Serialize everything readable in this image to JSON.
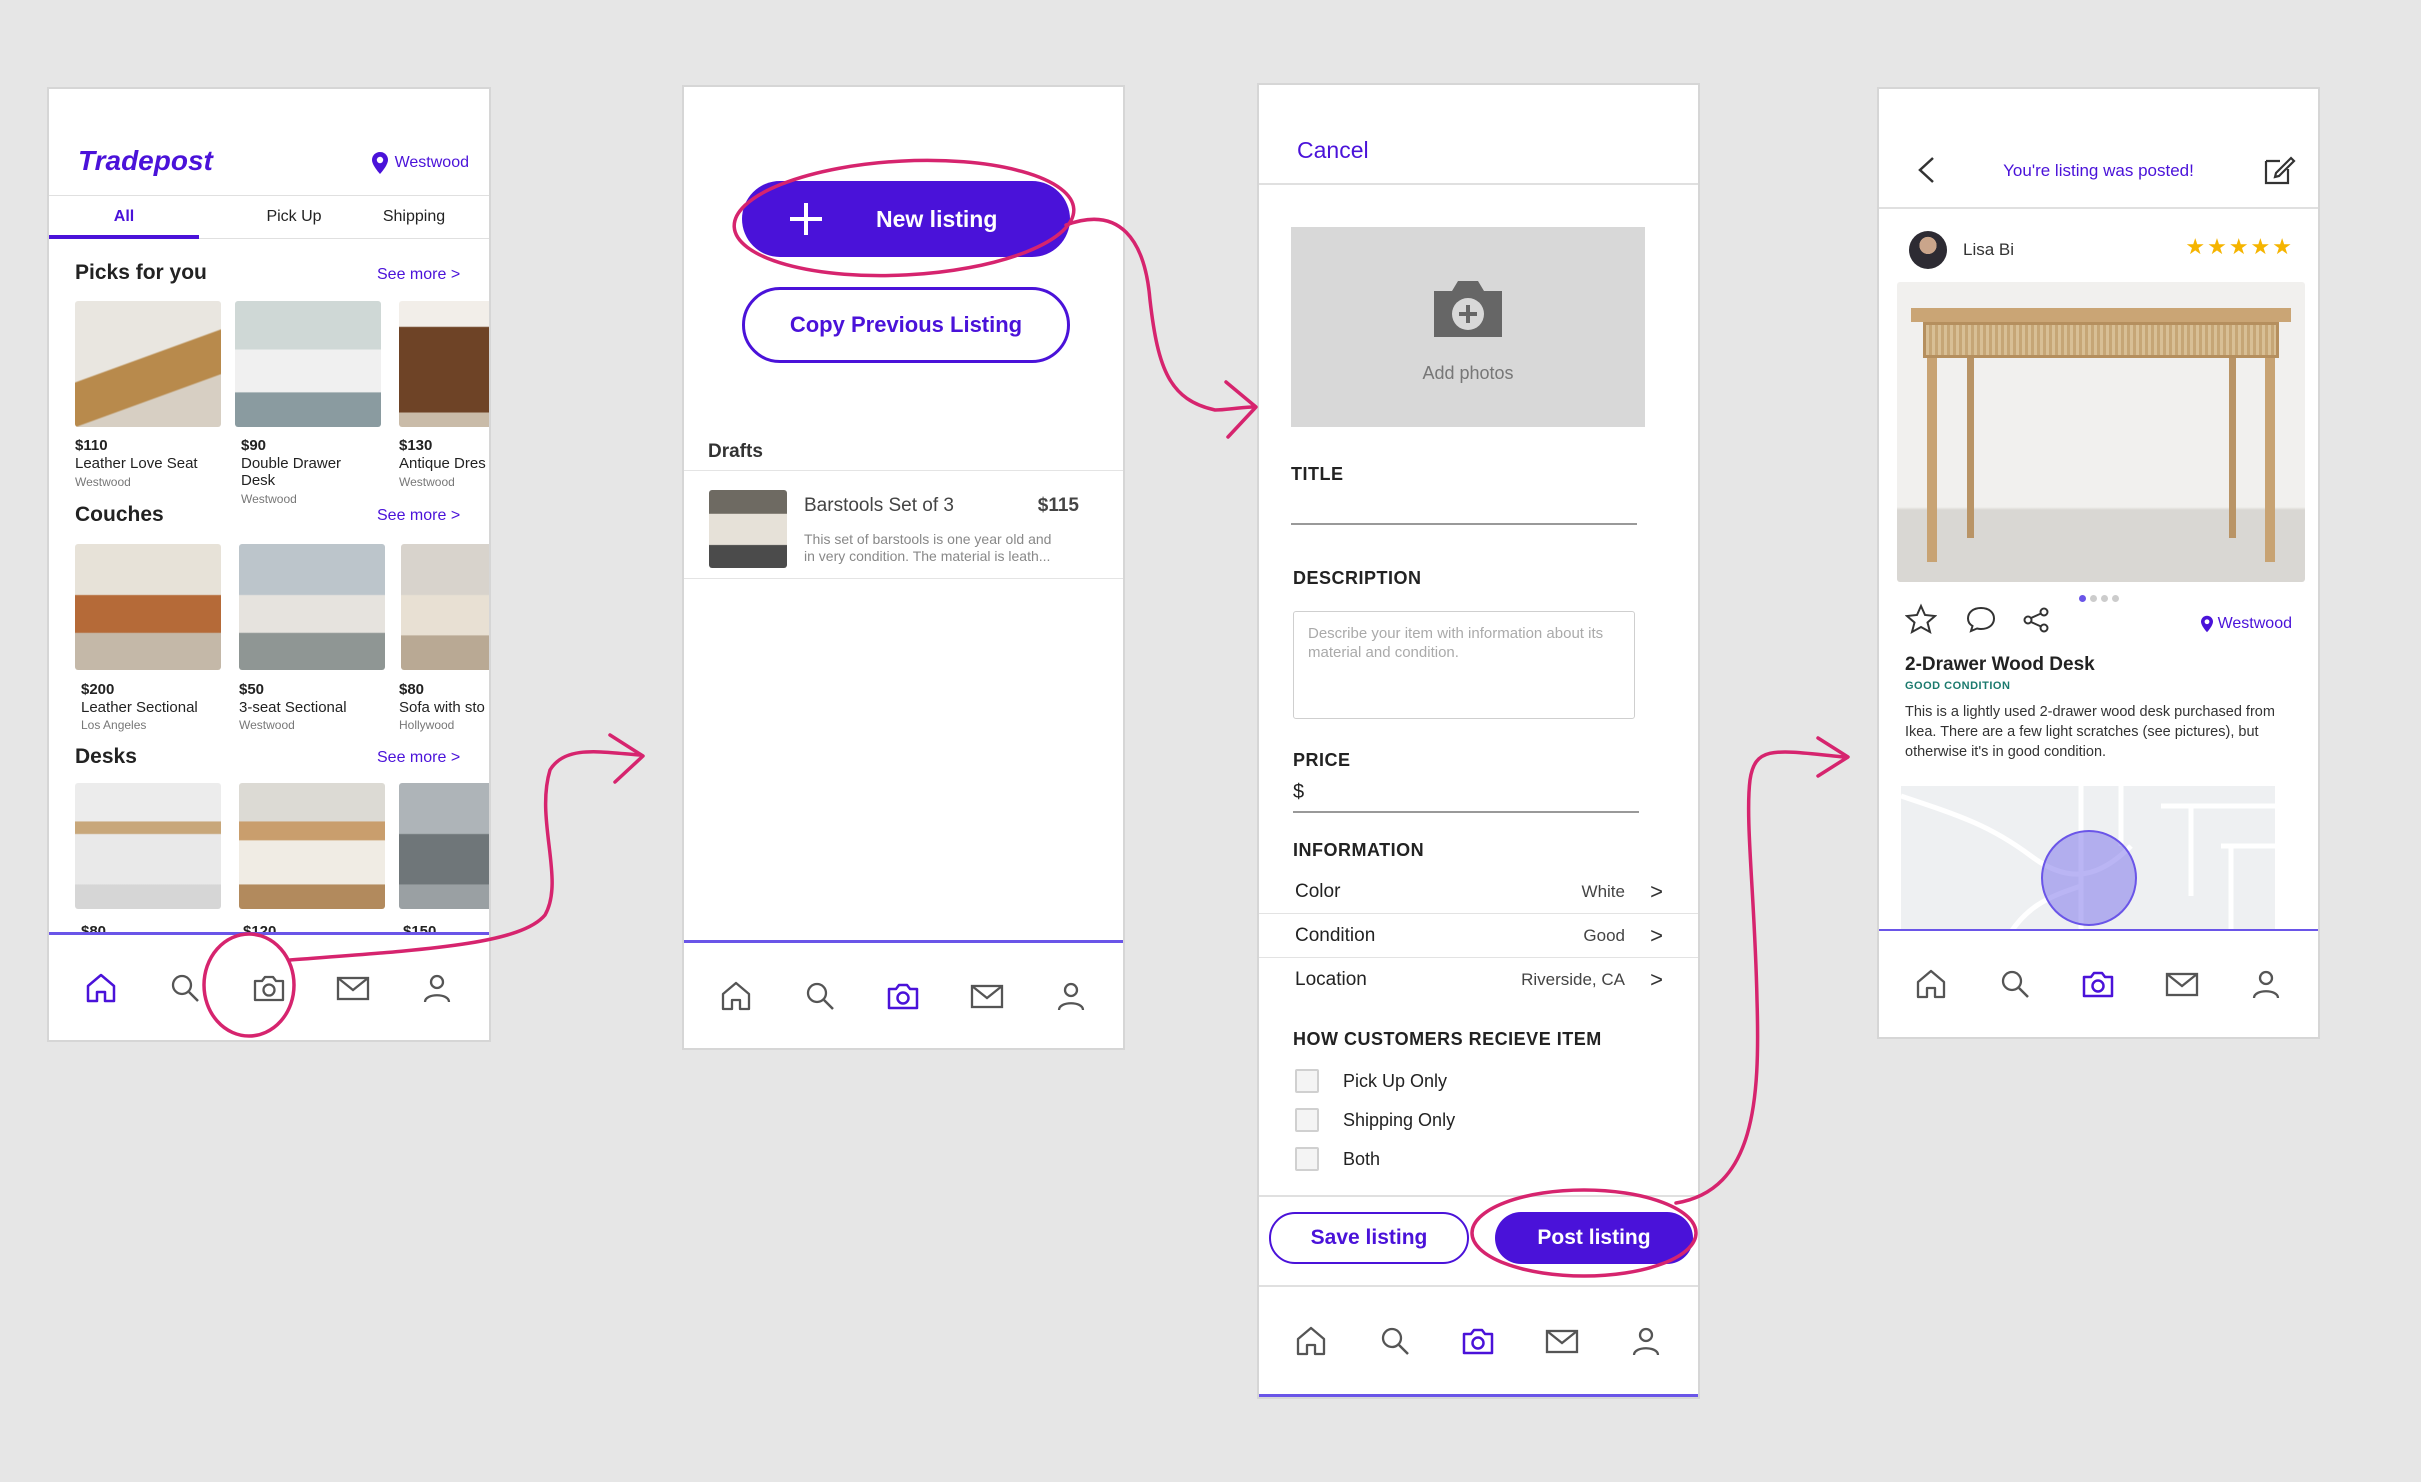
{
  "screen1": {
    "brand": "Tradepost",
    "location": "Westwood",
    "tabs": [
      "All",
      "Pick Up",
      "Shipping"
    ],
    "sections": [
      {
        "title": "Picks for you",
        "see_more": "See more >",
        "items": [
          {
            "price": "$110",
            "name": "Leather Love Seat",
            "loc": "Westwood"
          },
          {
            "price": "$90",
            "name": "Double Drawer Desk",
            "loc": "Westwood"
          },
          {
            "price": "$130",
            "name": "Antique Dres",
            "loc": "Westwood"
          }
        ]
      },
      {
        "title": "Couches",
        "see_more": "See more >",
        "items": [
          {
            "price": "$200",
            "name": "Leather Sectional",
            "loc": "Los Angeles"
          },
          {
            "price": "$50",
            "name": "3-seat Sectional",
            "loc": "Westwood"
          },
          {
            "price": "$80",
            "name": "Sofa with sto",
            "loc": "Hollywood"
          }
        ]
      },
      {
        "title": "Desks",
        "see_more": "See more >",
        "items": [
          {
            "price": "$80"
          },
          {
            "price": "$120"
          },
          {
            "price": "$150"
          }
        ]
      }
    ]
  },
  "screen2": {
    "new_listing": "New listing",
    "copy_previous": "Copy Previous Listing",
    "drafts_label": "Drafts",
    "draft": {
      "title": "Barstools Set of 3",
      "price": "$115",
      "desc_line1": "This set of barstools is one year old and",
      "desc_line2": "in very condition. The material is leath..."
    }
  },
  "screen3": {
    "cancel": "Cancel",
    "add_photos": "Add photos",
    "title_label": "TITLE",
    "description_label": "DESCRIPTION",
    "description_placeholder": "Describe your item with information about its material and condition.",
    "price_label": "PRICE",
    "price_prefix": "$",
    "information_label": "INFORMATION",
    "info": [
      {
        "key": "Color",
        "value": "White"
      },
      {
        "key": "Condition",
        "value": "Good"
      },
      {
        "key": "Location",
        "value": "Riverside, CA"
      }
    ],
    "receive_label": "HOW CUSTOMERS RECIEVE ITEM",
    "options": [
      "Pick Up Only",
      "Shipping Only",
      "Both"
    ],
    "save_listing": "Save listing",
    "post_listing": "Post listing"
  },
  "screen4": {
    "banner": "You're listing was posted!",
    "seller": "Lisa Bi",
    "rating": 5,
    "stars": "★★★★★",
    "location": "Westwood",
    "item_title": "2-Drawer Wood Desk",
    "condition": "GOOD CONDITION",
    "description": "This is a lightly used 2-drawer wood desk purchased from Ikea. There are a few light scratches (see pictures), but otherwise it's in good condition."
  },
  "colors": {
    "accent": "#4a12d9",
    "annotation": "#d6246e",
    "background": "#e6e6e6",
    "star": "#f5b400"
  }
}
